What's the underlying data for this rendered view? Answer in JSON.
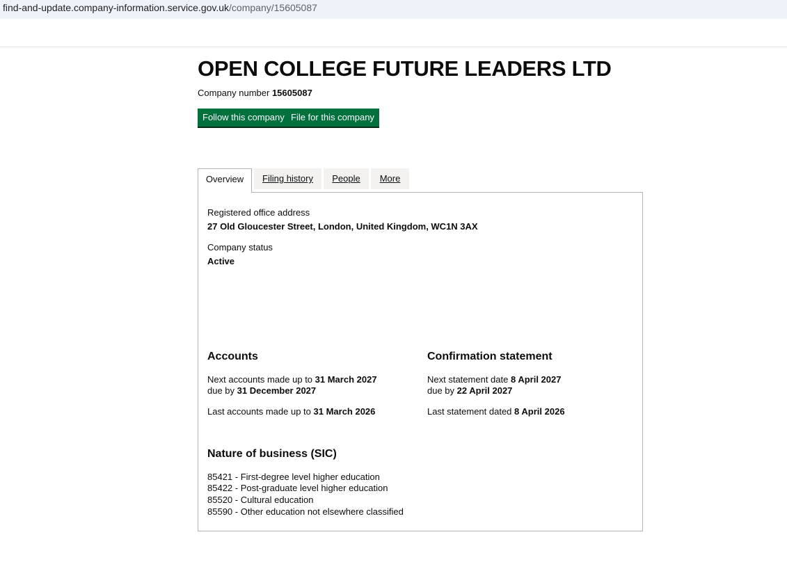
{
  "browser": {
    "url_host": "find-and-update.company-information.service.gov.uk",
    "url_path": "/company/15605087"
  },
  "company": {
    "name": "OPEN COLLEGE FUTURE LEADERS LTD",
    "number_label": "Company number",
    "number": "15605087"
  },
  "actions": {
    "follow_label": "Follow this company",
    "file_label": "File for this company"
  },
  "tabs": {
    "overview": "Overview",
    "filing_history": "Filing history",
    "people": "People",
    "more": "More"
  },
  "overview": {
    "address_label": "Registered office address",
    "address_value": "27 Old Gloucester Street, London, United Kingdom, WC1N 3AX",
    "status_label": "Company status",
    "status_value": "Active"
  },
  "accounts": {
    "heading": "Accounts",
    "next_prefix": "Next accounts made up to",
    "next_date": "31 March 2027",
    "due_prefix": "due by",
    "due_date": "31 December 2027",
    "last_prefix": "Last accounts made up to",
    "last_date": "31 March 2026"
  },
  "confirmation": {
    "heading": "Confirmation statement",
    "next_prefix": "Next statement date",
    "next_date": "8 April 2027",
    "due_prefix": "due by",
    "due_date": "22 April 2027",
    "last_prefix": "Last statement dated",
    "last_date": "8 April 2026"
  },
  "sic": {
    "heading": "Nature of business (SIC)",
    "items": [
      "85421 - First-degree level higher education",
      "85422 - Post-graduate level higher education",
      "85520 - Cultural education",
      "85590 - Other education not elsewhere classified"
    ]
  },
  "colors": {
    "button_green": "#00703c",
    "panel_border": "#b1b4b6",
    "tab_inactive": "#f3f2f1"
  }
}
